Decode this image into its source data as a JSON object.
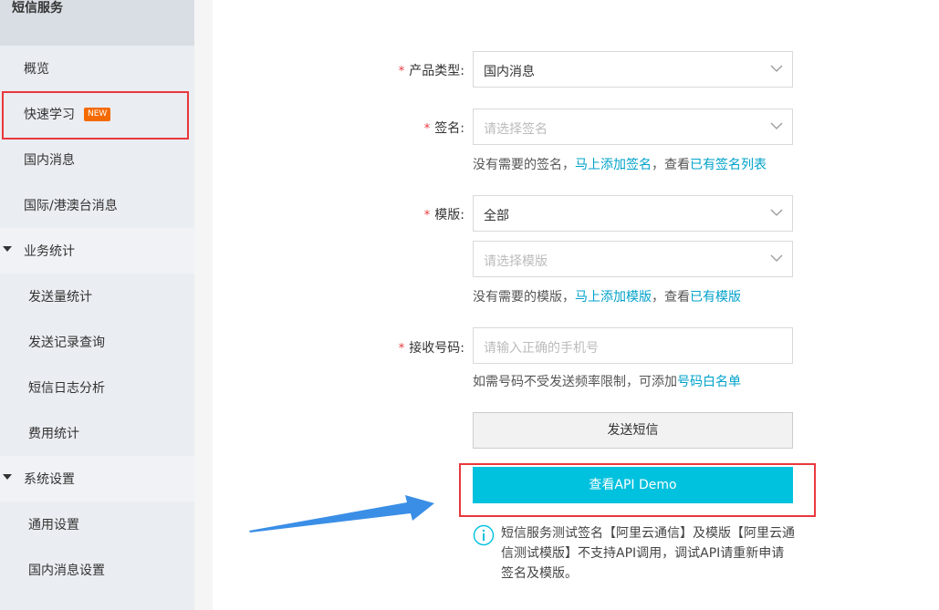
{
  "sidebar": {
    "title": "短信服务",
    "items": [
      {
        "label": "概览"
      },
      {
        "label": "快速学习",
        "badge": "NEW"
      },
      {
        "label": "国内消息"
      },
      {
        "label": "国际/港澳台消息"
      }
    ],
    "groups": [
      {
        "label": "业务统计",
        "children": [
          "发送量统计",
          "发送记录查询",
          "短信日志分析",
          "费用统计"
        ]
      },
      {
        "label": "系统设置",
        "children": [
          "通用设置",
          "国内消息设置"
        ]
      }
    ]
  },
  "form": {
    "required_mark": "*",
    "product_type": {
      "label": "产品类型:",
      "value": "国内消息"
    },
    "signature": {
      "label": "签名:",
      "placeholder": "请选择签名",
      "hint_prefix": "没有需要的签名，",
      "hint_link1": "马上添加签名",
      "hint_mid": "，查看",
      "hint_link2": "已有签名列表"
    },
    "template": {
      "label": "模版:",
      "value": "全部",
      "placeholder": "请选择模版",
      "hint_prefix": "没有需要的模版，",
      "hint_link1": "马上添加模版",
      "hint_mid": "，查看",
      "hint_link2": "已有模版"
    },
    "phone": {
      "label": "接收号码:",
      "placeholder": "请输入正确的手机号",
      "hint_prefix": "如需号码不受发送频率限制，可添加",
      "hint_link": "号码白名单"
    },
    "send_button": "发送短信",
    "api_button": "查看API Demo",
    "info": "短信服务测试签名【阿里云通信】及模版【阿里云通信测试模版】不支持API调用，调试API请重新申请签名及模版。"
  },
  "colors": {
    "accent": "#00c1de",
    "link": "#00a2ca",
    "highlight": "#e8383d",
    "badge": "#f56a00",
    "arrow": "#3a8ee6"
  }
}
